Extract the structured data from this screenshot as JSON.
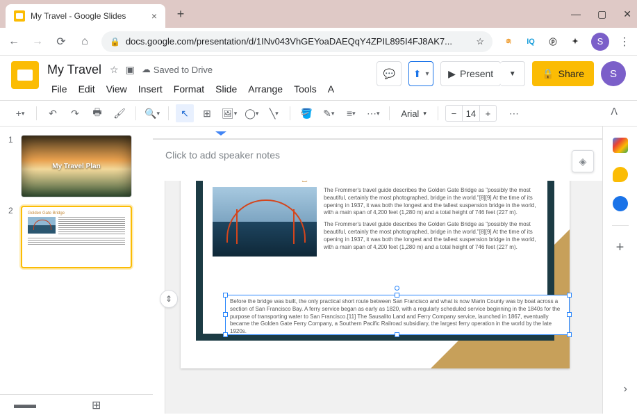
{
  "browser": {
    "tab_title": "My Travel - Google Slides",
    "url": "docs.google.com/presentation/d/1INv043VhGEYoaDAEQqY4ZPIL895I4FJ8AK7..."
  },
  "header": {
    "doc_title": "My Travel",
    "saved_status": "Saved to Drive",
    "avatar_letter": "S"
  },
  "menu": {
    "items": [
      "File",
      "Edit",
      "View",
      "Insert",
      "Format",
      "Slide",
      "Arrange",
      "Tools",
      "A"
    ]
  },
  "header_buttons": {
    "present": "Present",
    "share": "Share"
  },
  "toolbar": {
    "font_name": "Arial",
    "font_size": "14"
  },
  "thumbnails": {
    "slide1": {
      "num": "1",
      "title": "My Travel Plan"
    },
    "slide2": {
      "num": "2",
      "title": "Golden Gate Bridge"
    }
  },
  "slide": {
    "title": "Golden Gate Bridge",
    "para1": "The Frommer's travel guide describes the Golden Gate Bridge as \"possibly the most beautiful, certainly the most photographed, bridge in the world.\"[8][9] At the time of its opening in 1937, it was both the longest and the tallest suspension bridge in the world, with a main span of 4,200 feet (1,280 m) and a total height of 746 feet (227 m).",
    "para2": "The Frommer's travel guide describes the Golden Gate Bridge as \"possibly the most beautiful, certainly the most photographed, bridge in the world.\"[8][9] At the time of its opening in 1937, it was both the longest and the tallest suspension bridge in the world, with a main span of 4,200 feet (1,280 m) and a total height of 746 feet (227 m).",
    "textbox": "Before the bridge was built, the only practical short route between San Francisco and what is now Marin County was by boat across a section of San Francisco Bay. A ferry service began as early as 1820, with a regularly scheduled service beginning in the 1840s for the purpose of transporting water to San Francisco.[11] The Sausalito Land and Ferry Company service, launched in 1867, eventually became the Golden Gate Ferry Company, a Southern Pacific Railroad subsidiary, the largest ferry operation in the world by the late 1920s."
  },
  "notes": {
    "placeholder": "Click to add speaker notes"
  }
}
